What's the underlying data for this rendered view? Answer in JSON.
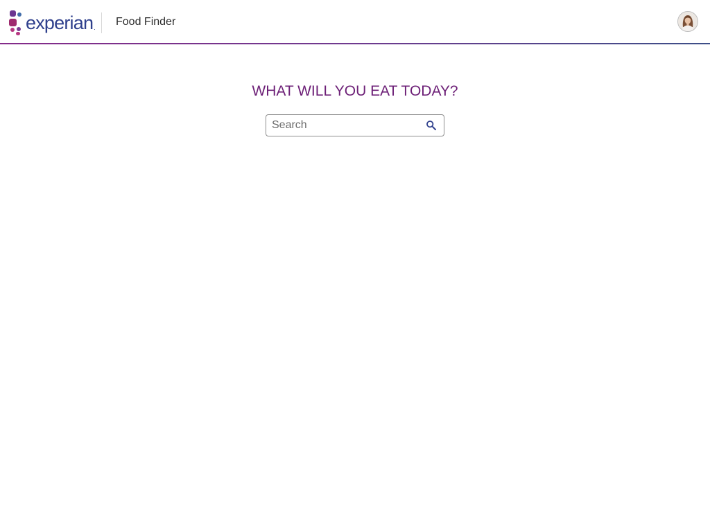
{
  "header": {
    "logo_text": "experian",
    "logo_dot": ".",
    "app_title": "Food Finder",
    "avatar_icon": "user-avatar"
  },
  "main": {
    "heading": "WHAT WILL YOU EAT TODAY?",
    "search": {
      "placeholder": "Search",
      "value": "",
      "icon": "search-icon"
    }
  },
  "colors": {
    "brand_purple": "#6d2077",
    "brand_blue": "#2e3f8c",
    "header_rule_start": "#842b8a",
    "header_rule_end": "#3d4f88"
  }
}
